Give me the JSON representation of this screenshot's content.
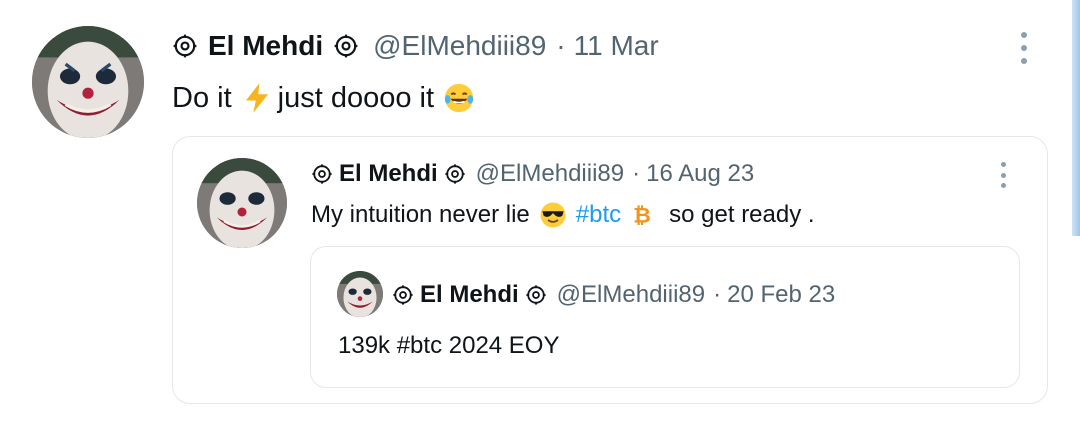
{
  "tweet": {
    "name": "El Mehdi",
    "handle": "@ElMehdiii89",
    "separator": "·",
    "date": "11 Mar",
    "text_before": "Do it",
    "text_after": "just doooo it"
  },
  "quote": {
    "name": "El Mehdi",
    "handle": "@ElMehdiii89",
    "separator": "·",
    "date": "16 Aug 23",
    "text_before": "My intuition never lie",
    "hashtag": "#btc",
    "text_after": "so get ready ."
  },
  "nested_quote": {
    "name": "El Mehdi",
    "handle": "@ElMehdiii89",
    "separator": "·",
    "date": "20 Feb 23",
    "text": "139k #btc 2024 EOY"
  },
  "icons": {
    "gear": "gear-badge-icon",
    "more": "more-options-icon",
    "lightning": "lightning-emoji",
    "laughing": "tears-of-joy-emoji",
    "sunglasses": "sunglasses-emoji",
    "bitcoin": "bitcoin-icon"
  },
  "colors": {
    "hashtag": "#1d9bf0",
    "secondary_text": "#536471",
    "border": "#e4e8eb",
    "bitcoin": "#f7931a"
  }
}
